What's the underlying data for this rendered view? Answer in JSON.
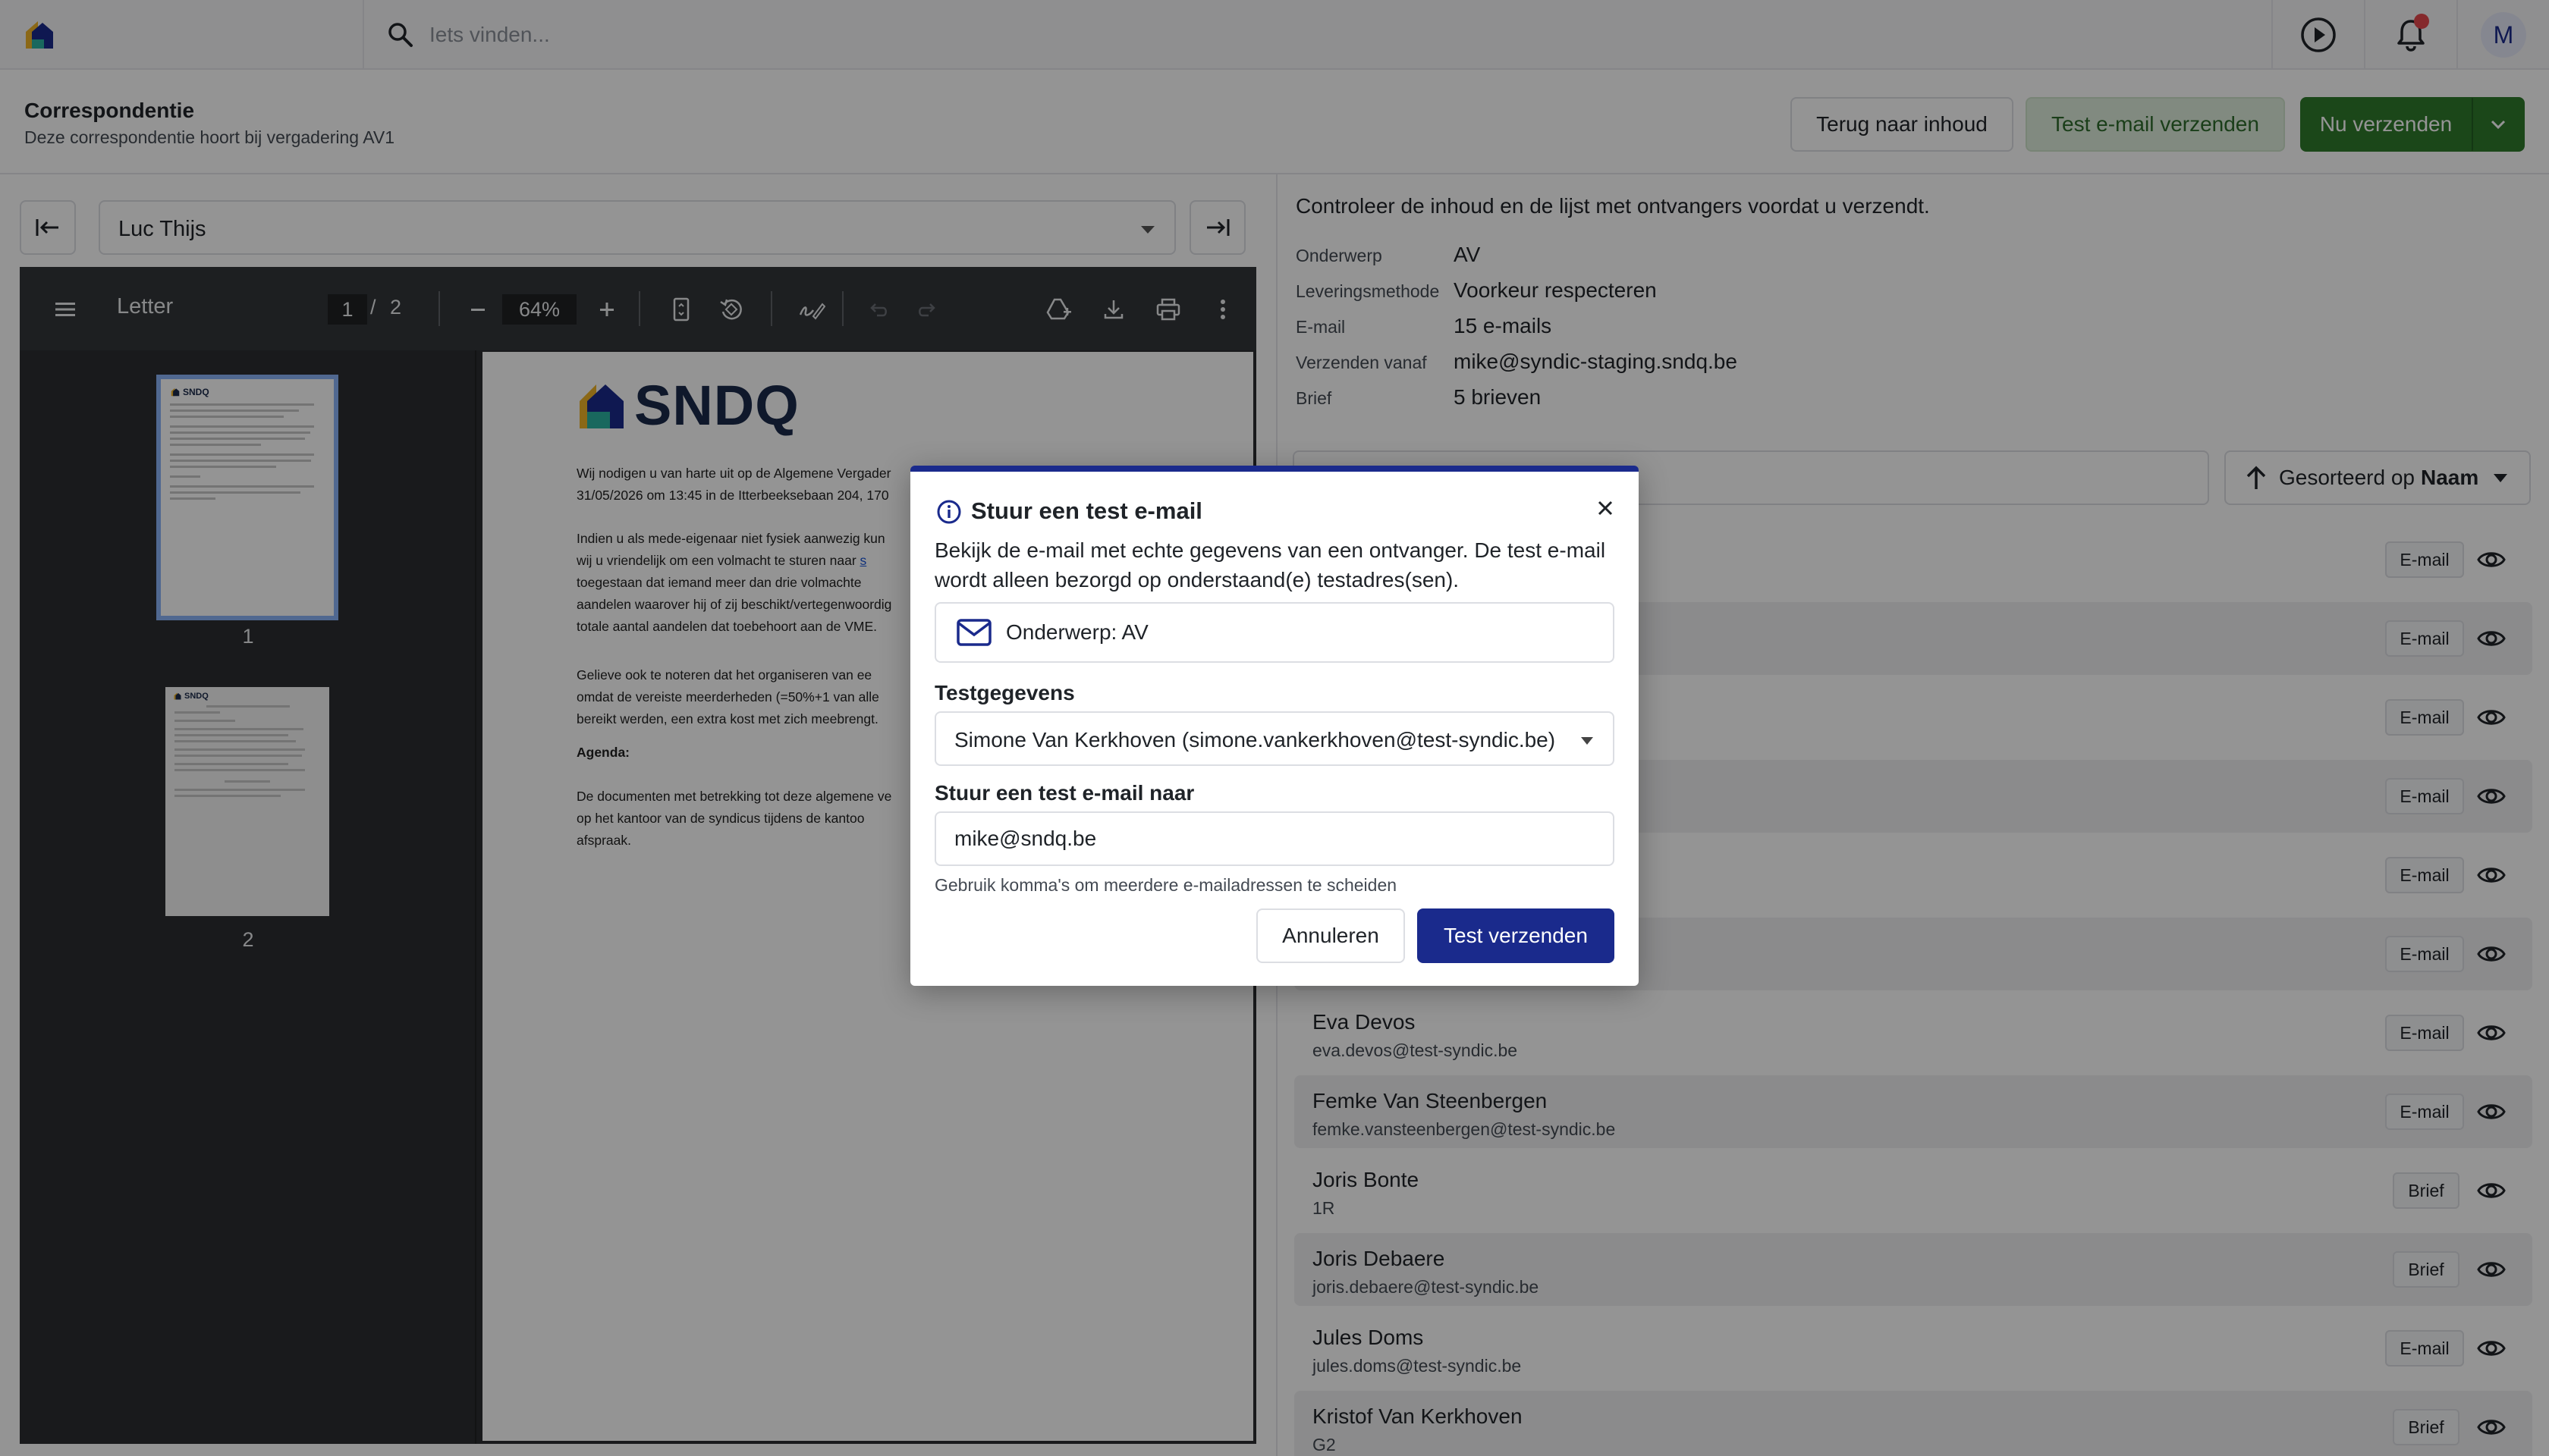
{
  "topbar": {
    "search_placeholder": "Iets vinden...",
    "avatar_initial": "M"
  },
  "header": {
    "title": "Correspondentie",
    "subtitle": "Deze correspondentie hoort bij vergadering AV1",
    "back_label": "Terug naar inhoud",
    "test_email_label": "Test e-mail verzenden",
    "send_now_label": "Nu verzenden"
  },
  "left": {
    "recipient_selected": "Luc Thijs",
    "pdf": {
      "name": "Letter",
      "current_page": "1",
      "page_sep": "/",
      "total_pages": "2",
      "zoom": "64%",
      "thumbnails": [
        {
          "label": "1"
        },
        {
          "label": "2"
        }
      ],
      "logo_text": "SNDQ",
      "paragraphs": [
        [
          "Wij nodigen u van harte uit op de Algemene Vergader",
          "31/05/2026 om 13:45 in de Itterbeeksebaan 204, 170"
        ],
        [
          "Indien u als mede-eigenaar niet fysiek aanwezig kun",
          "wij u vriendelijk om een volmacht te sturen naar",
          "toegestaan dat iemand meer dan drie volmachte",
          "aandelen waarover hij of zij beschikt/vertegenwoordig",
          "totale aantal aandelen dat toebehoort aan de VME."
        ],
        [
          "Gelieve ook te noteren dat het organiseren van ee",
          "omdat de vereiste meerderheden (=50%+1 van alle",
          "bereikt werden, een extra kost met zich meebrengt."
        ],
        [
          "Agenda:"
        ],
        [
          "De documenten met betrekking tot deze algemene ve",
          "op het kantoor van de syndicus tijdens de kantoo",
          "afspraak."
        ]
      ]
    }
  },
  "right": {
    "intro": "Controleer de inhoud en de lijst met ontvangers voordat u verzendt.",
    "meta": [
      {
        "label": "Onderwerp",
        "value": "AV"
      },
      {
        "label": "Leveringsmethode",
        "value": "Voorkeur respecteren"
      },
      {
        "label": "E-mail",
        "value": "15 e-mails"
      },
      {
        "label": "Verzenden vanaf",
        "value": "mike@syndic-staging.sndq.be"
      },
      {
        "label": "Brief",
        "value": "5 brieven"
      }
    ],
    "sort_prefix": "Gesorteerd op",
    "sort_field": "Naam",
    "recipients": [
      {
        "name": "",
        "sub": "",
        "method": "E-mail"
      },
      {
        "name": "",
        "sub": "",
        "method": "E-mail"
      },
      {
        "name": "",
        "sub": "",
        "method": "E-mail"
      },
      {
        "name": "",
        "sub": "",
        "method": "E-mail"
      },
      {
        "name": "",
        "sub": "",
        "method": "E-mail"
      },
      {
        "name": "",
        "sub": "",
        "method": "E-mail"
      },
      {
        "name": "Eva Devos",
        "sub": "eva.devos@test-syndic.be",
        "method": "E-mail"
      },
      {
        "name": "Femke Van Steenbergen",
        "sub": "femke.vansteenbergen@test-syndic.be",
        "method": "E-mail"
      },
      {
        "name": "Joris Bonte",
        "sub": "1R",
        "method": "Brief"
      },
      {
        "name": "Joris Debaere",
        "sub": "joris.debaere@test-syndic.be",
        "method": "Brief"
      },
      {
        "name": "Jules Doms",
        "sub": "jules.doms@test-syndic.be",
        "method": "E-mail"
      },
      {
        "name": "Kristof Van Kerkhoven",
        "sub": "G2",
        "method": "Brief"
      }
    ]
  },
  "modal": {
    "title": "Stuur een test e-mail",
    "description": "Bekijk de e-mail met echte gegevens van een ontvanger. De test e-mail wordt alleen bezorgd op onderstaand(e) testadres(sen).",
    "subject": "Onderwerp: AV",
    "test_data_label": "Testgegevens",
    "test_data_value": "Simone Van Kerkhoven (simone.vankerkhoven@test-syndic.be)",
    "send_to_label": "Stuur een test e-mail naar",
    "send_to_value": "mike@sndq.be",
    "hint": "Gebruik komma's om meerdere e-mailadressen te scheiden",
    "cancel_label": "Annuleren",
    "submit_label": "Test verzenden"
  },
  "colors": {
    "primary": "#1a2a8c",
    "success": "#2f7a2c",
    "success_soft": "#dfeedd",
    "notification": "#e5484d"
  }
}
